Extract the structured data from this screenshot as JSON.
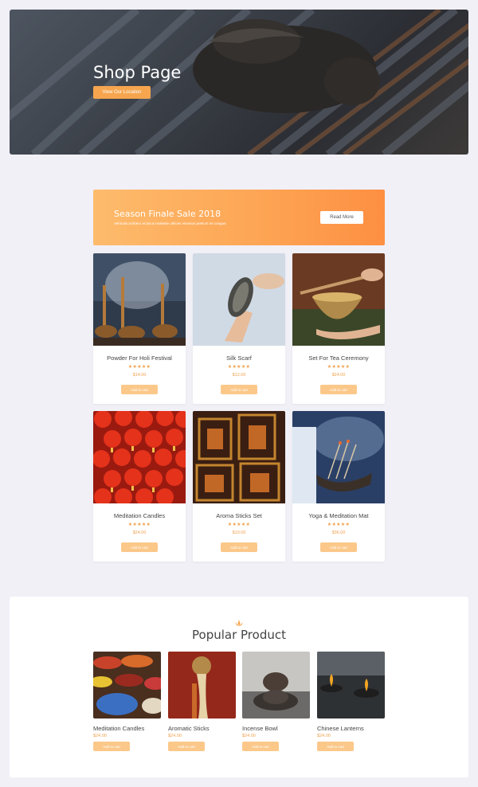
{
  "hero": {
    "title": "Shop Page",
    "button_label": "View Our Location"
  },
  "promo": {
    "title": "Season Finale Sale 2018",
    "subtitle": "Vehicula at libero et lacus molestie ultrices vivamus pretium mi congue.",
    "button_label": "Read More"
  },
  "products": [
    {
      "name": "Powder For Holi Festival",
      "stars": "★★★★★",
      "price": "$14.00",
      "cart": "Add to cart",
      "rating": 5
    },
    {
      "name": "Silk Scarf",
      "stars": "★★★★★",
      "price": "$12.00",
      "cart": "Add to cart",
      "rating": 5
    },
    {
      "name": "Set For Tea Ceremony",
      "stars": "★★★★★",
      "price": "$24.00",
      "cart": "Add to cart",
      "rating": 5
    },
    {
      "name": "Meditation Candles",
      "stars": "★★★★★",
      "price": "$24.00",
      "cart": "Add to cart",
      "rating": 5
    },
    {
      "name": "Aroma Sticks Set",
      "stars": "★★★★★",
      "price": "$19.00",
      "cart": "Add to cart",
      "rating": 5
    },
    {
      "name": "Yoga & Meditation Mat",
      "stars": "★★★★★",
      "price": "$36.00",
      "cart": "Add to cart",
      "rating": 5
    }
  ],
  "popular": {
    "title": "Popular Product",
    "items": [
      {
        "name": "Meditation Candles",
        "price": "$24.00",
        "cart": "Add to cart"
      },
      {
        "name": "Aromatic Sticks",
        "price": "$24.00",
        "cart": "Add to cart"
      },
      {
        "name": "Incense Bowl",
        "price": "$24.00",
        "cart": "Add to cart"
      },
      {
        "name": "Chinese Lanterns",
        "price": "$24.00",
        "cart": "Add to cart"
      }
    ]
  },
  "colors": {
    "accent": "#f6a54e",
    "accent_light": "#fbc88a",
    "star": "#f0a04b",
    "page_bg": "#f1f0f7"
  }
}
